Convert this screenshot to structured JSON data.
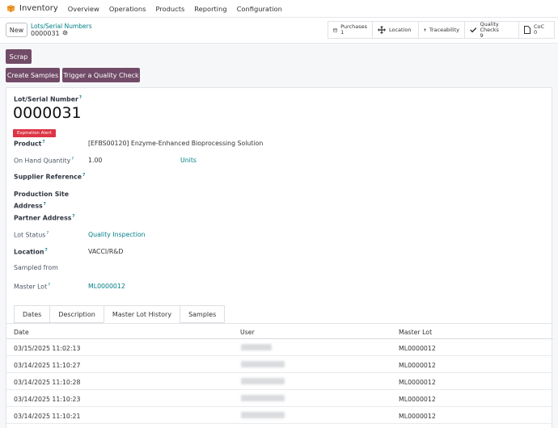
{
  "nav": {
    "app_name": "Inventory",
    "menu": [
      "Overview",
      "Operations",
      "Products",
      "Reporting",
      "Configuration"
    ]
  },
  "control_panel": {
    "new_label": "New",
    "breadcrumb_parent": "Lots/Serial Numbers",
    "breadcrumb_current": "0000031",
    "smart_buttons": [
      {
        "label": "Purchases",
        "count": "1",
        "icon": "credit-card-icon"
      },
      {
        "label": "Location",
        "count": "",
        "icon": "move-arrows-icon"
      },
      {
        "label": "Traceability",
        "count": "",
        "icon": "arrow-up-icon"
      },
      {
        "label": "Quality Checks",
        "count": "9",
        "icon": "check-icon"
      },
      {
        "label": "CoC",
        "count": "0",
        "icon": "document-icon"
      }
    ]
  },
  "actions": {
    "scrap": "Scrap",
    "create_samples": "Create Samples",
    "trigger_quality_check": "Trigger a Quality Check"
  },
  "form": {
    "title_label": "Lot/Serial Number",
    "title_value": "0000031",
    "expiration_badge": "Expiration Alert",
    "product_label": "Product",
    "product_value": "[EFBS00120] Enzyme-Enhanced Bioprocessing Solution",
    "on_hand_label": "On Hand Quantity",
    "on_hand_value": "1.00",
    "on_hand_unit": "Units",
    "supplier_ref_label": "Supplier Reference",
    "production_site_label_1": "Production Site",
    "production_site_label_2": "Address",
    "partner_address_label": "Partner Address",
    "lot_status_label": "Lot Status",
    "lot_status_value": "Quality Inspection",
    "location_label": "Location",
    "location_value": "VACCI/R&D",
    "sampled_from_label": "Sampled from",
    "master_lot_label": "Master Lot",
    "master_lot_value": "ML0000012",
    "help_mark": "?"
  },
  "tabs": [
    "Dates",
    "Description",
    "Master Lot History",
    "Samples"
  ],
  "history": {
    "headers": [
      "Date",
      "User",
      "Master Lot"
    ],
    "rows": [
      {
        "date": "03/15/2025 11:02:13",
        "master_lot": "ML0000012"
      },
      {
        "date": "03/14/2025 11:10:27",
        "master_lot": "ML0000012"
      },
      {
        "date": "03/14/2025 11:10:28",
        "master_lot": "ML0000012"
      },
      {
        "date": "03/14/2025 11:10:23",
        "master_lot": "ML0000012"
      },
      {
        "date": "03/14/2025 11:10:21",
        "master_lot": "ML0000012"
      }
    ]
  },
  "colors": {
    "primary": "#714b67",
    "link": "#017e84",
    "danger": "#dc3545"
  }
}
